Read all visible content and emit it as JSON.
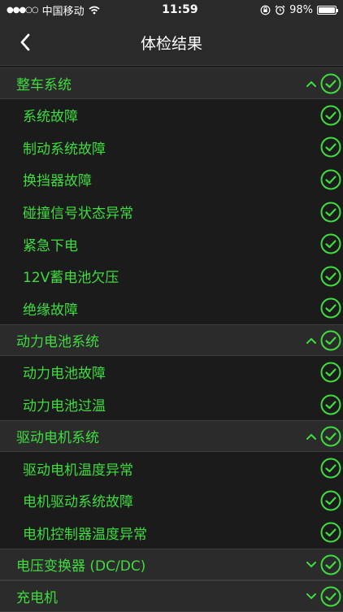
{
  "status_bar": {
    "signal": "●●●○○",
    "carrier": "中国移动",
    "time": "11:59",
    "battery": "98%",
    "battery_level": 0.98
  },
  "nav": {
    "title": "体检结果"
  },
  "sections": [
    {
      "title": "整车系统",
      "expanded": true,
      "items": [
        "系统故障",
        "制动系统故障",
        "换挡器故障",
        "碰撞信号状态异常",
        "紧急下电",
        "12V蓄电池欠压",
        "绝缘故障"
      ]
    },
    {
      "title": "动力电池系统",
      "expanded": true,
      "items": [
        "动力电池故障",
        "动力电池过温"
      ]
    },
    {
      "title": "驱动电机系统",
      "expanded": true,
      "items": [
        "驱动电机温度异常",
        "电机驱动系统故障",
        "电机控制器温度异常"
      ]
    },
    {
      "title": "电压变换器 (DC/DC)",
      "expanded": false,
      "items": []
    },
    {
      "title": "充电机",
      "expanded": false,
      "items": []
    }
  ],
  "colors": {
    "accent": "#3fdc3f",
    "header_bg": "#2b2b2b",
    "row_bg": "#1b1b1b"
  }
}
